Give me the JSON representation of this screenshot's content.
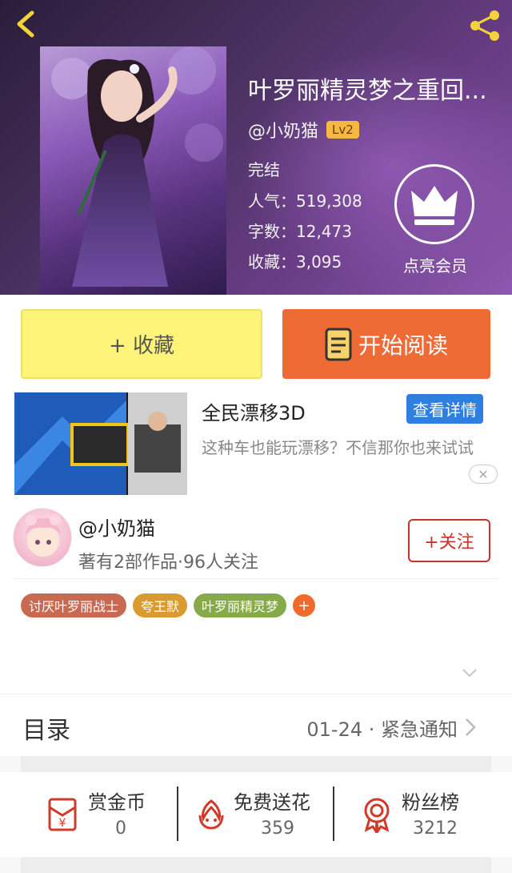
{
  "header": {
    "title": "叶罗丽精灵梦之重回...",
    "author": "@小奶猫",
    "level": "Lv2",
    "status": "完结",
    "popularity": "人气：519,308",
    "word_count": "字数：12,473",
    "favorites": "收藏：3,095",
    "vip_label": "点亮会员"
  },
  "actions": {
    "favorite_label": "+ 收藏",
    "read_label": "开始阅读"
  },
  "ad": {
    "title": "全民漂移3D",
    "details_label": "查看详情",
    "description": "这种车也能玩漂移？不信那你也来试试",
    "close": "✕"
  },
  "author_card": {
    "name": "@小奶猫",
    "meta": "著有2部作品·96人关注",
    "follow_label": "+关注",
    "tags": [
      {
        "label": "讨厌叶罗丽战士",
        "color": "#c86a52"
      },
      {
        "label": "夸王默",
        "color": "#d99a2f"
      },
      {
        "label": "叶罗丽精灵梦",
        "color": "#86a94a"
      }
    ],
    "add_tag": "+"
  },
  "catalog": {
    "title": "目录",
    "latest": "01-24 · 紧急通知"
  },
  "stats": {
    "reward": {
      "label": "赏金币",
      "value": "0"
    },
    "flowers": {
      "label": "免费送花",
      "value": "359"
    },
    "fans": {
      "label": "粉丝榜",
      "value": "3212"
    }
  },
  "colors": {
    "accent_orange": "#ee6b36",
    "favorite_yellow": "#fff47a",
    "follow_red": "#c8332b",
    "level_badge": "#f5b942"
  }
}
